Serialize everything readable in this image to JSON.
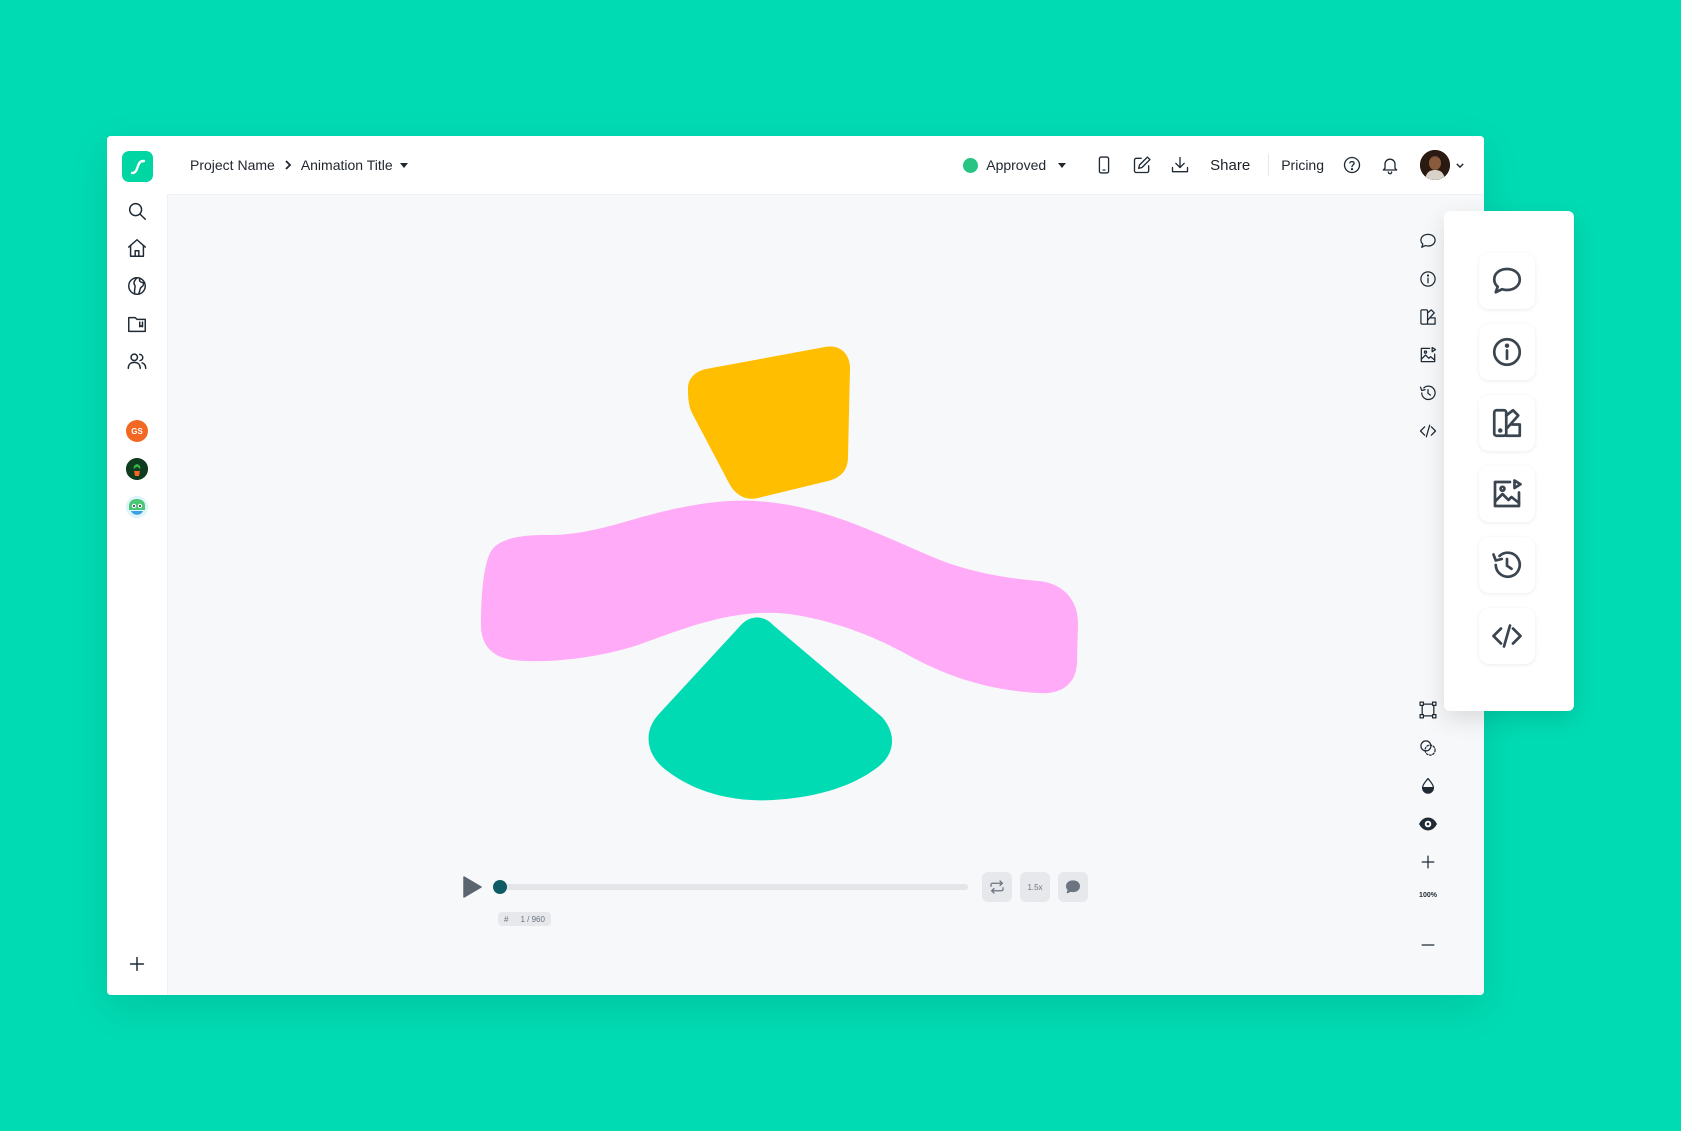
{
  "colors": {
    "background": "#00dbb3",
    "brand": "#00d5a4",
    "approved": "#27c483",
    "shape_yellow": "#ffbe00",
    "shape_pink": "#ffabf7",
    "shape_teal": "#00dbb3",
    "scrubber": "#0e5c63"
  },
  "header": {
    "breadcrumb_project": "Project Name",
    "breadcrumb_animation": "Animation Title",
    "status_label": "Approved",
    "share_label": "Share",
    "pricing_label": "Pricing"
  },
  "sidebar": {
    "nav_icons": [
      "search-icon",
      "home-icon",
      "globe-icon",
      "folder-icon",
      "users-icon"
    ],
    "workspaces": [
      {
        "initials": "GS",
        "color": "#f26722"
      },
      {
        "name": "plant-avatar"
      },
      {
        "name": "bird-avatar"
      }
    ],
    "add_icon": "plus-icon"
  },
  "toolbar_right": {
    "top_icons": [
      "comment-icon",
      "info-icon",
      "theme-icon",
      "image-export-icon",
      "history-icon",
      "code-icon"
    ],
    "bottom_icons": [
      "bounding-box-icon",
      "layers-icon",
      "fill-icon",
      "eye-icon"
    ],
    "zoom_level": "100%"
  },
  "player": {
    "frame_hash": "#",
    "frame_counter": "1 / 960",
    "speed": "1.5x",
    "progress": 0.0
  },
  "side_panel": {
    "icons": [
      "comment-icon",
      "info-icon",
      "theme-icon",
      "image-export-icon",
      "history-icon",
      "code-icon"
    ]
  }
}
